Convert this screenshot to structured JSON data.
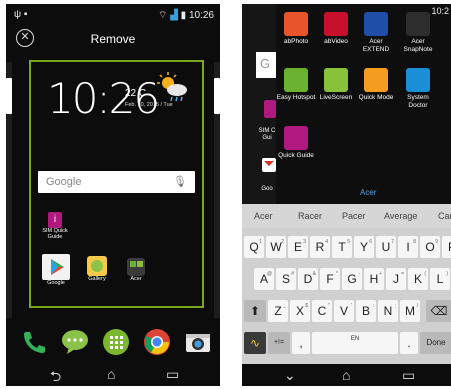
{
  "left_phone": {
    "status_time": "10:26",
    "remove_label": "Remove",
    "clock_time": "10:26",
    "temperature": "22 C",
    "date": "Feb. 10, 2015 / Tue",
    "search_logo": "Google",
    "apps": [
      {
        "label": "SIM Quick Guide",
        "icon": "sim-guide-icon"
      },
      {
        "label": "Google",
        "icon": "play-store-icon"
      },
      {
        "label": "Gallery",
        "icon": "gallery-icon"
      },
      {
        "label": "Acer",
        "icon": "acer-folder-icon"
      }
    ],
    "dock": [
      "phone-icon",
      "messaging-icon",
      "app-drawer-icon",
      "chrome-icon",
      "camera-icon"
    ],
    "nav": [
      "back-icon",
      "home-icon",
      "recents-icon"
    ]
  },
  "right_phone": {
    "status_time": "10:2",
    "drawer_apps": [
      {
        "label": "abPhoto",
        "icon": "abphoto-icon",
        "color": "#e8542b"
      },
      {
        "label": "abVideo",
        "icon": "abvideo-icon",
        "color": "#c8102e"
      },
      {
        "label": "Acer EXTEND",
        "icon": "acer-extend-icon",
        "color": "#1f4fa8"
      },
      {
        "label": "Acer SnapNote",
        "icon": "snapnote-icon",
        "color": "#2d2d2d"
      },
      {
        "label": "Easy Hotspot",
        "icon": "hotspot-icon",
        "color": "#6ab22f"
      },
      {
        "label": "LiveScreen",
        "icon": "livescreen-icon",
        "color": "#88c23a"
      },
      {
        "label": "Quick Mode",
        "icon": "quick-mode-icon",
        "color": "#f39c1f"
      },
      {
        "label": "System Doctor",
        "icon": "system-doctor-icon",
        "color": "#1a8fd6"
      },
      {
        "label": "Quick Guide",
        "icon": "quick-guide-icon",
        "color": "#b0197e"
      }
    ],
    "folder_name": "Acer",
    "strip": {
      "search_letter": "G",
      "sim_label": "SIM C Gui",
      "goo_label": "Goo"
    },
    "suggestions": [
      "Acer",
      "Racer",
      "Pacer",
      "Average",
      "Car"
    ],
    "rows": [
      [
        {
          "k": "Q",
          "s": "1"
        },
        {
          "k": "W",
          "s": "2"
        },
        {
          "k": "E",
          "s": "3"
        },
        {
          "k": "R",
          "s": "4"
        },
        {
          "k": "T",
          "s": "5"
        },
        {
          "k": "Y",
          "s": "6"
        },
        {
          "k": "U",
          "s": "7"
        },
        {
          "k": "I",
          "s": "8"
        },
        {
          "k": "O",
          "s": "9"
        },
        {
          "k": "P",
          "s": "0"
        }
      ],
      [
        {
          "k": "A",
          "s": "@"
        },
        {
          "k": "S",
          "s": "#"
        },
        {
          "k": "D",
          "s": "&"
        },
        {
          "k": "F",
          "s": "*"
        },
        {
          "k": "G",
          "s": "-"
        },
        {
          "k": "H",
          "s": "+"
        },
        {
          "k": "J",
          "s": "="
        },
        {
          "k": "K",
          "s": "("
        },
        {
          "k": "L",
          "s": ")"
        }
      ],
      [
        {
          "k": "Z",
          "s": "_"
        },
        {
          "k": "X",
          "s": "$"
        },
        {
          "k": "C",
          "s": "\""
        },
        {
          "k": "V",
          "s": "'"
        },
        {
          "k": "B",
          "s": ":"
        },
        {
          "k": "N",
          "s": ";"
        },
        {
          "k": "M",
          "s": "/"
        }
      ]
    ],
    "space_label": "EN",
    "symbols_label": "+!=",
    "done_label": "Done",
    "comma": ",",
    "period": "."
  }
}
